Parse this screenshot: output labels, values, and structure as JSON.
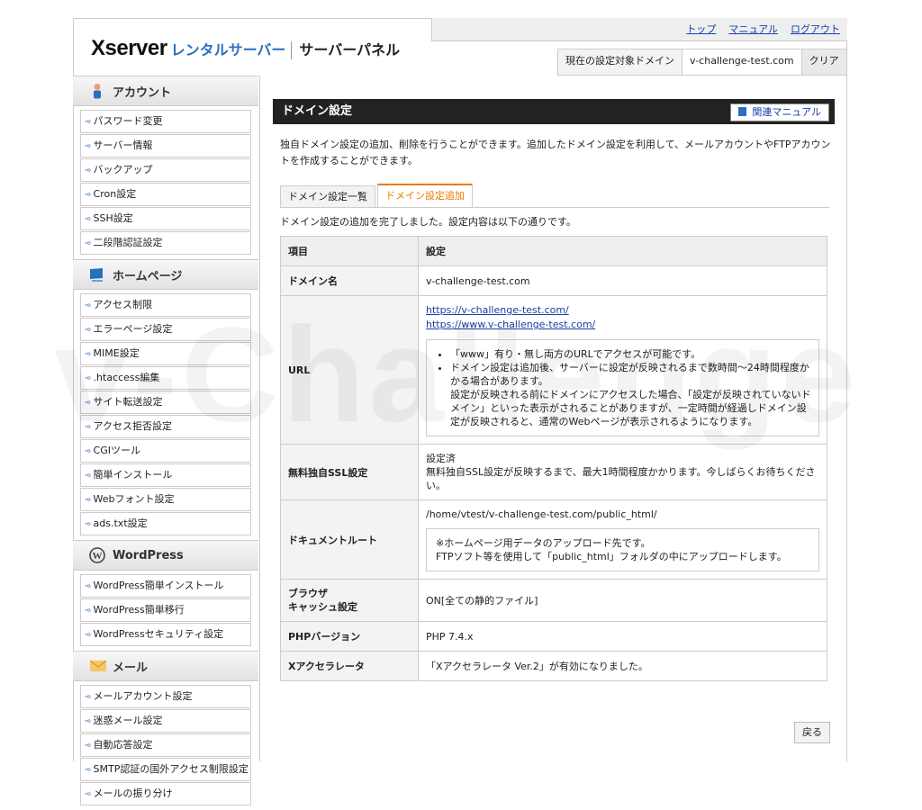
{
  "header": {
    "logo_brand": "Xserver",
    "logo_rental": "レンタルサーバー",
    "logo_panel": "サーバーパネル",
    "links": [
      "トップ",
      "マニュアル",
      "ログアウト"
    ],
    "domain_label": "現在の設定対象ドメイン",
    "domain_value": "v-challenge-test.com",
    "clear_label": "クリア"
  },
  "sidebar": {
    "account": {
      "title": "アカウント",
      "items": [
        "パスワード変更",
        "サーバー情報",
        "バックアップ",
        "Cron設定",
        "SSH設定",
        "二段階認証設定"
      ]
    },
    "homepage": {
      "title": "ホームページ",
      "items": [
        "アクセス制限",
        "エラーページ設定",
        "MIME設定",
        ".htaccess編集",
        "サイト転送設定",
        "アクセス拒否設定",
        "CGIツール",
        "簡単インストール",
        "Webフォント設定",
        "ads.txt設定"
      ]
    },
    "wordpress": {
      "title": "WordPress",
      "items": [
        "WordPress簡単インストール",
        "WordPress簡単移行",
        "WordPressセキュリティ設定"
      ]
    },
    "mail": {
      "title": "メール",
      "items": [
        "メールアカウント設定",
        "迷惑メール設定",
        "自動応答設定",
        "SMTP認証の国外アクセス制限設定",
        "メールの振り分け"
      ]
    }
  },
  "main": {
    "title": "ドメイン設定",
    "manual_btn": "関連マニュアル",
    "intro": "独自ドメイン設定の追加、削除を行うことができます。追加したドメイン設定を利用して、メールアカウントやFTPアカウントを作成することができます。",
    "tabs": [
      "ドメイン設定一覧",
      "ドメイン設定追加"
    ],
    "done_message": "ドメイン設定の追加を完了しました。設定内容は以下の通りです。",
    "table": {
      "head_item": "項目",
      "head_setting": "設定",
      "domain_key": "ドメイン名",
      "domain_val": "v-challenge-test.com",
      "url_key": "URL",
      "url1": "https://v-challenge-test.com/",
      "url2": "https://www.v-challenge-test.com/",
      "url_note1": "「www」有り・無し両方のURLでアクセスが可能です。",
      "url_note2": "ドメイン設定は追加後、サーバーに設定が反映されるまで数時間〜24時間程度かかる場合があります。",
      "url_note3": "設定が反映される前にドメインにアクセスした場合、「設定が反映されていないドメイン」といった表示がされることがありますが、一定時間が経過しドメイン設定が反映されると、通常のWebページが表示されるようになります。",
      "ssl_key": "無料独自SSL設定",
      "ssl_val1": "設定済",
      "ssl_val2": "無料独自SSL設定が反映するまで、最大1時間程度かかります。今しばらくお待ちください。",
      "docroot_key": "ドキュメントルート",
      "docroot_val": "/home/vtest/v-challenge-test.com/public_html/",
      "docroot_note1": "※ホームページ用データのアップロード先です。",
      "docroot_note2": "FTPソフト等を使用して「public_html」フォルダの中にアップロードします。",
      "cache_key1": "ブラウザ",
      "cache_key2": "キャッシュ設定",
      "cache_val": "ON[全ての静的ファイル]",
      "php_key": "PHPバージョン",
      "php_val": "PHP 7.4.x",
      "xacc_key": "Xアクセラレータ",
      "xacc_val": "「Xアクセラレータ Ver.2」が有効になりました。"
    },
    "back_btn": "戻る"
  }
}
